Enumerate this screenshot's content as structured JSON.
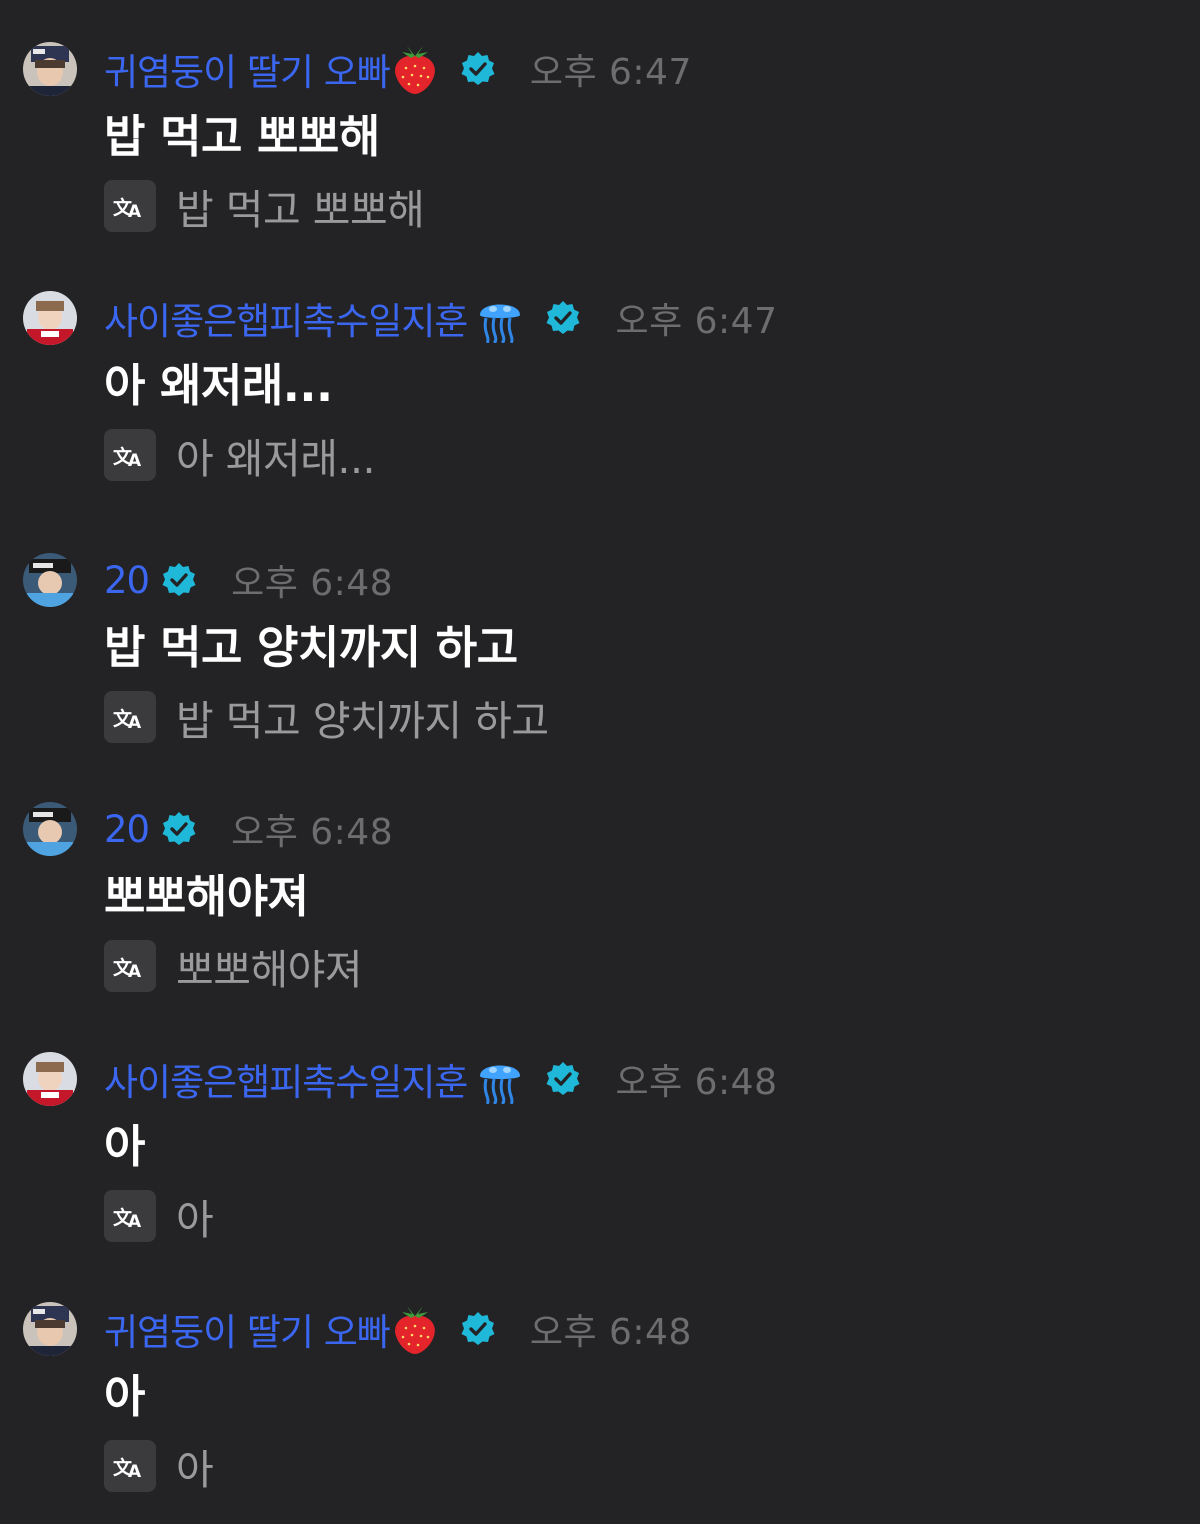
{
  "messages": [
    {
      "username": "귀염둥이 딸기 오빠",
      "emoji": "strawberry",
      "avatar": "avatar-a",
      "time": "오후 6:47",
      "text": "밥 먹고 뽀뽀해",
      "translation": "밥 먹고 뽀뽀해"
    },
    {
      "username": "사이좋은햅피촉수일지훈",
      "emoji": "jellyfish",
      "avatar": "avatar-b",
      "time": "오후 6:47",
      "text": "아 왜저래...",
      "translation": "아 왜저래..."
    },
    {
      "username": "20",
      "emoji": "",
      "avatar": "avatar-c",
      "time": "오후 6:48",
      "text": "밥 먹고 양치까지 하고",
      "translation": "밥 먹고 양치까지 하고"
    },
    {
      "username": "20",
      "emoji": "",
      "avatar": "avatar-c",
      "time": "오후 6:48",
      "text": "뽀뽀해야져",
      "translation": "뽀뽀해야져"
    },
    {
      "username": "사이좋은햅피촉수일지훈",
      "emoji": "jellyfish",
      "avatar": "avatar-b",
      "time": "오후 6:48",
      "text": "아",
      "translation": "아"
    },
    {
      "username": "귀염둥이 딸기 오빠",
      "emoji": "strawberry",
      "avatar": "avatar-a",
      "time": "오후 6:48",
      "text": "아",
      "translation": "아"
    }
  ],
  "icons": {
    "verified": "verified-badge-icon",
    "translate": "translate-icon",
    "strawberry": "strawberry-emoji-icon",
    "jellyfish": "jellyfish-emoji-icon"
  },
  "colors": {
    "background": "#232325",
    "username": "#3b66f0",
    "timestamp": "#6d6d70",
    "message": "#ffffff",
    "translation": "#9a9a9d",
    "verified": "#1fb8d8",
    "translate_button": "#3b3b3e"
  }
}
